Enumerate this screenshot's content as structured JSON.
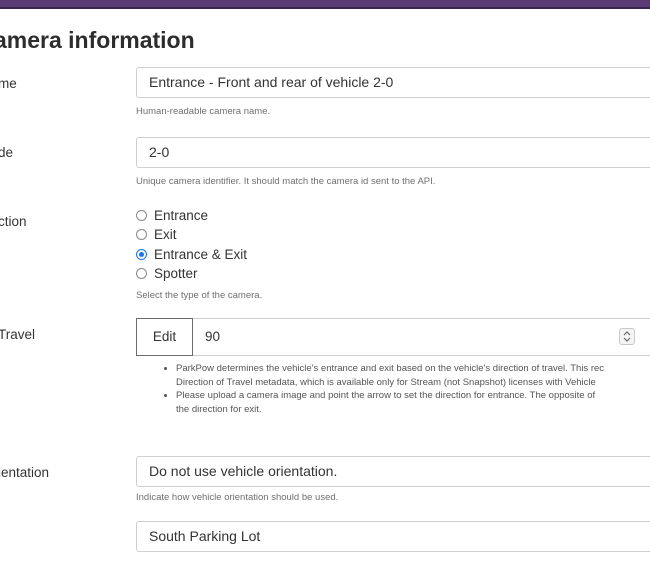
{
  "page": {
    "title": "amera information"
  },
  "fields": {
    "name": {
      "label": "me",
      "value": "Entrance - Front and rear of vehicle 2-0",
      "help": "Human-readable camera name."
    },
    "code": {
      "label": "de",
      "value": "2-0",
      "help": "Unique camera identifier. It should match the camera id sent to the API."
    },
    "direction": {
      "label": "ction",
      "options": [
        "Entrance",
        "Exit",
        "Entrance & Exit",
        "Spotter"
      ],
      "selected": "Entrance & Exit",
      "help": "Select the type of the camera."
    },
    "travel": {
      "label": "Travel",
      "edit_label": "Edit",
      "value": "90",
      "notes": [
        [
          "ParkPow determines the vehicle's entrance and exit based on the vehicle's direction of travel. This rec",
          "Direction of Travel metadata, which is available only for Stream (not Snapshot) licenses with Vehicle"
        ],
        [
          "Please upload a camera image and point the arrow to set the direction for entrance. The opposite of",
          "the direction for exit."
        ]
      ]
    },
    "orientation": {
      "label": "ientation",
      "value": "Do not use vehicle orientation.",
      "help": "Indicate how vehicle orientation should be used."
    },
    "parking_lot": {
      "value": "South Parking Lot"
    }
  },
  "colors": {
    "accent": "#5a3a72",
    "radio": "#1a73e8"
  },
  "icons": {
    "spinner": "spinner-arrows-icon"
  }
}
